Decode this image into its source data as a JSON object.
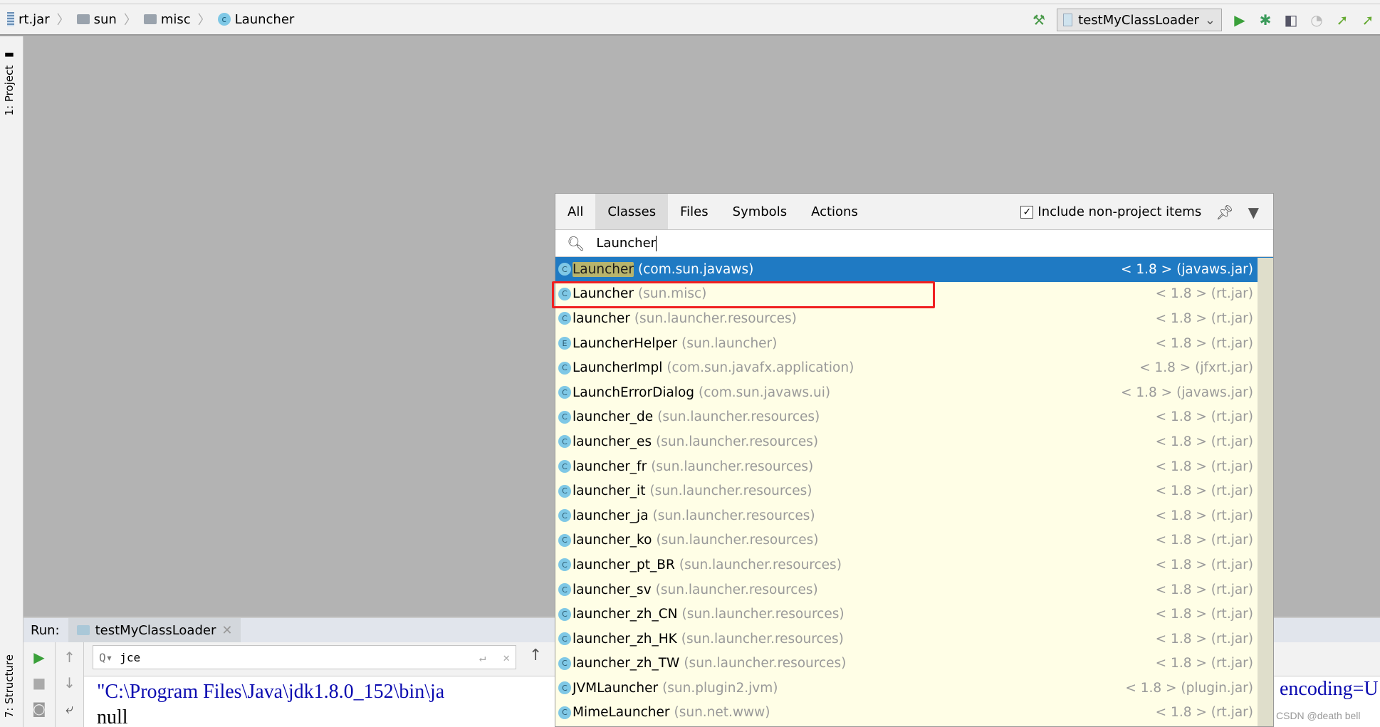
{
  "breadcrumb": [
    {
      "icon": "jar-icon",
      "label": "rt.jar"
    },
    {
      "icon": "folder-icon",
      "label": "sun"
    },
    {
      "icon": "folder-icon",
      "label": "misc"
    },
    {
      "icon": "class-icon",
      "label": "Launcher"
    }
  ],
  "toolbar": {
    "run_config": "testMyClassLoader"
  },
  "left_strip": {
    "project": "1: Project",
    "structure": "7: Structure"
  },
  "run_panel": {
    "label": "Run:",
    "tab": "testMyClassLoader",
    "find_value": "jce",
    "console_lines": [
      "\"C:\\Program Files\\Java\\jdk1.8.0_152\\bin\\ja",
      "null"
    ],
    "console_tail": "encoding=U"
  },
  "popup": {
    "tabs": [
      "All",
      "Classes",
      "Files",
      "Symbols",
      "Actions"
    ],
    "active_tab": "Classes",
    "include_label": "Include non-project items",
    "include_checked": true,
    "search_value": "Launcher",
    "results": [
      {
        "kind": "C",
        "name": "Launcher",
        "pkg": "(com.sun.javaws)",
        "loc": "< 1.8 > (javaws.jar)",
        "selected": true
      },
      {
        "kind": "C",
        "name": "Launcher",
        "pkg": "(sun.misc)",
        "loc": "< 1.8 > (rt.jar)",
        "highlighted": true
      },
      {
        "kind": "C",
        "name": "launcher",
        "pkg": "(sun.launcher.resources)",
        "loc": "< 1.8 > (rt.jar)"
      },
      {
        "kind": "E",
        "name": "LauncherHelper",
        "pkg": "(sun.launcher)",
        "loc": "< 1.8 > (rt.jar)"
      },
      {
        "kind": "C",
        "name": "LauncherImpl",
        "pkg": "(com.sun.javafx.application)",
        "loc": "< 1.8 > (jfxrt.jar)"
      },
      {
        "kind": "C",
        "name": "LaunchErrorDialog",
        "pkg": "(com.sun.javaws.ui)",
        "loc": "< 1.8 > (javaws.jar)"
      },
      {
        "kind": "C",
        "name": "launcher_de",
        "pkg": "(sun.launcher.resources)",
        "loc": "< 1.8 > (rt.jar)"
      },
      {
        "kind": "C",
        "name": "launcher_es",
        "pkg": "(sun.launcher.resources)",
        "loc": "< 1.8 > (rt.jar)"
      },
      {
        "kind": "C",
        "name": "launcher_fr",
        "pkg": "(sun.launcher.resources)",
        "loc": "< 1.8 > (rt.jar)"
      },
      {
        "kind": "C",
        "name": "launcher_it",
        "pkg": "(sun.launcher.resources)",
        "loc": "< 1.8 > (rt.jar)"
      },
      {
        "kind": "C",
        "name": "launcher_ja",
        "pkg": "(sun.launcher.resources)",
        "loc": "< 1.8 > (rt.jar)"
      },
      {
        "kind": "C",
        "name": "launcher_ko",
        "pkg": "(sun.launcher.resources)",
        "loc": "< 1.8 > (rt.jar)"
      },
      {
        "kind": "C",
        "name": "launcher_pt_BR",
        "pkg": "(sun.launcher.resources)",
        "loc": "< 1.8 > (rt.jar)"
      },
      {
        "kind": "C",
        "name": "launcher_sv",
        "pkg": "(sun.launcher.resources)",
        "loc": "< 1.8 > (rt.jar)"
      },
      {
        "kind": "C",
        "name": "launcher_zh_CN",
        "pkg": "(sun.launcher.resources)",
        "loc": "< 1.8 > (rt.jar)"
      },
      {
        "kind": "C",
        "name": "launcher_zh_HK",
        "pkg": "(sun.launcher.resources)",
        "loc": "< 1.8 > (rt.jar)"
      },
      {
        "kind": "C",
        "name": "launcher_zh_TW",
        "pkg": "(sun.launcher.resources)",
        "loc": "< 1.8 > (rt.jar)"
      },
      {
        "kind": "C",
        "name": "JVMLauncher",
        "pkg": "(sun.plugin2.jvm)",
        "loc": "< 1.8 > (plugin.jar)"
      },
      {
        "kind": "C",
        "name": "MimeLauncher",
        "pkg": "(sun.net.www)",
        "loc": "< 1.8 > (rt.jar)"
      }
    ]
  },
  "watermark": "CSDN @death bell",
  "colors": {
    "selection": "#1f7ac3",
    "highlight_box": "#f02020",
    "list_bg": "#fffee6"
  }
}
